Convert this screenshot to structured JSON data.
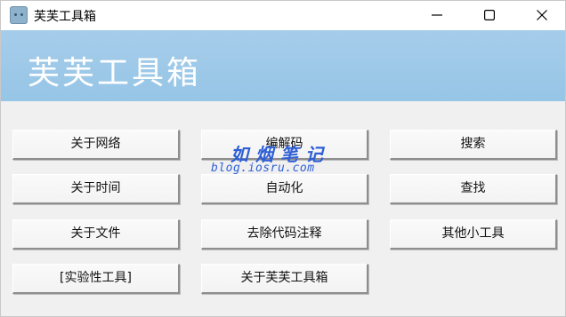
{
  "window": {
    "title": "芙芙工具箱"
  },
  "banner": {
    "title": "芙芙工具箱",
    "color": "#9fcbe9"
  },
  "buttons": {
    "about_network": "关于网络",
    "codec": "编解码",
    "search": "搜索",
    "about_time": "关于时间",
    "automation": "自动化",
    "find": "查找",
    "about_file": "关于文件",
    "remove_code_comments": "去除代码注释",
    "other_tools": "其他小工具",
    "experimental_tools": "[实验性工具]",
    "about_app": "关于芙芙工具箱"
  },
  "watermark": {
    "main": "如烟笔记",
    "sub": "blog.iosru.com",
    "color": "#2e5fd6"
  },
  "icons": {
    "app": "toolbox-app-icon",
    "minimize": "minimize-icon",
    "maximize": "maximize-icon",
    "close": "close-icon"
  }
}
